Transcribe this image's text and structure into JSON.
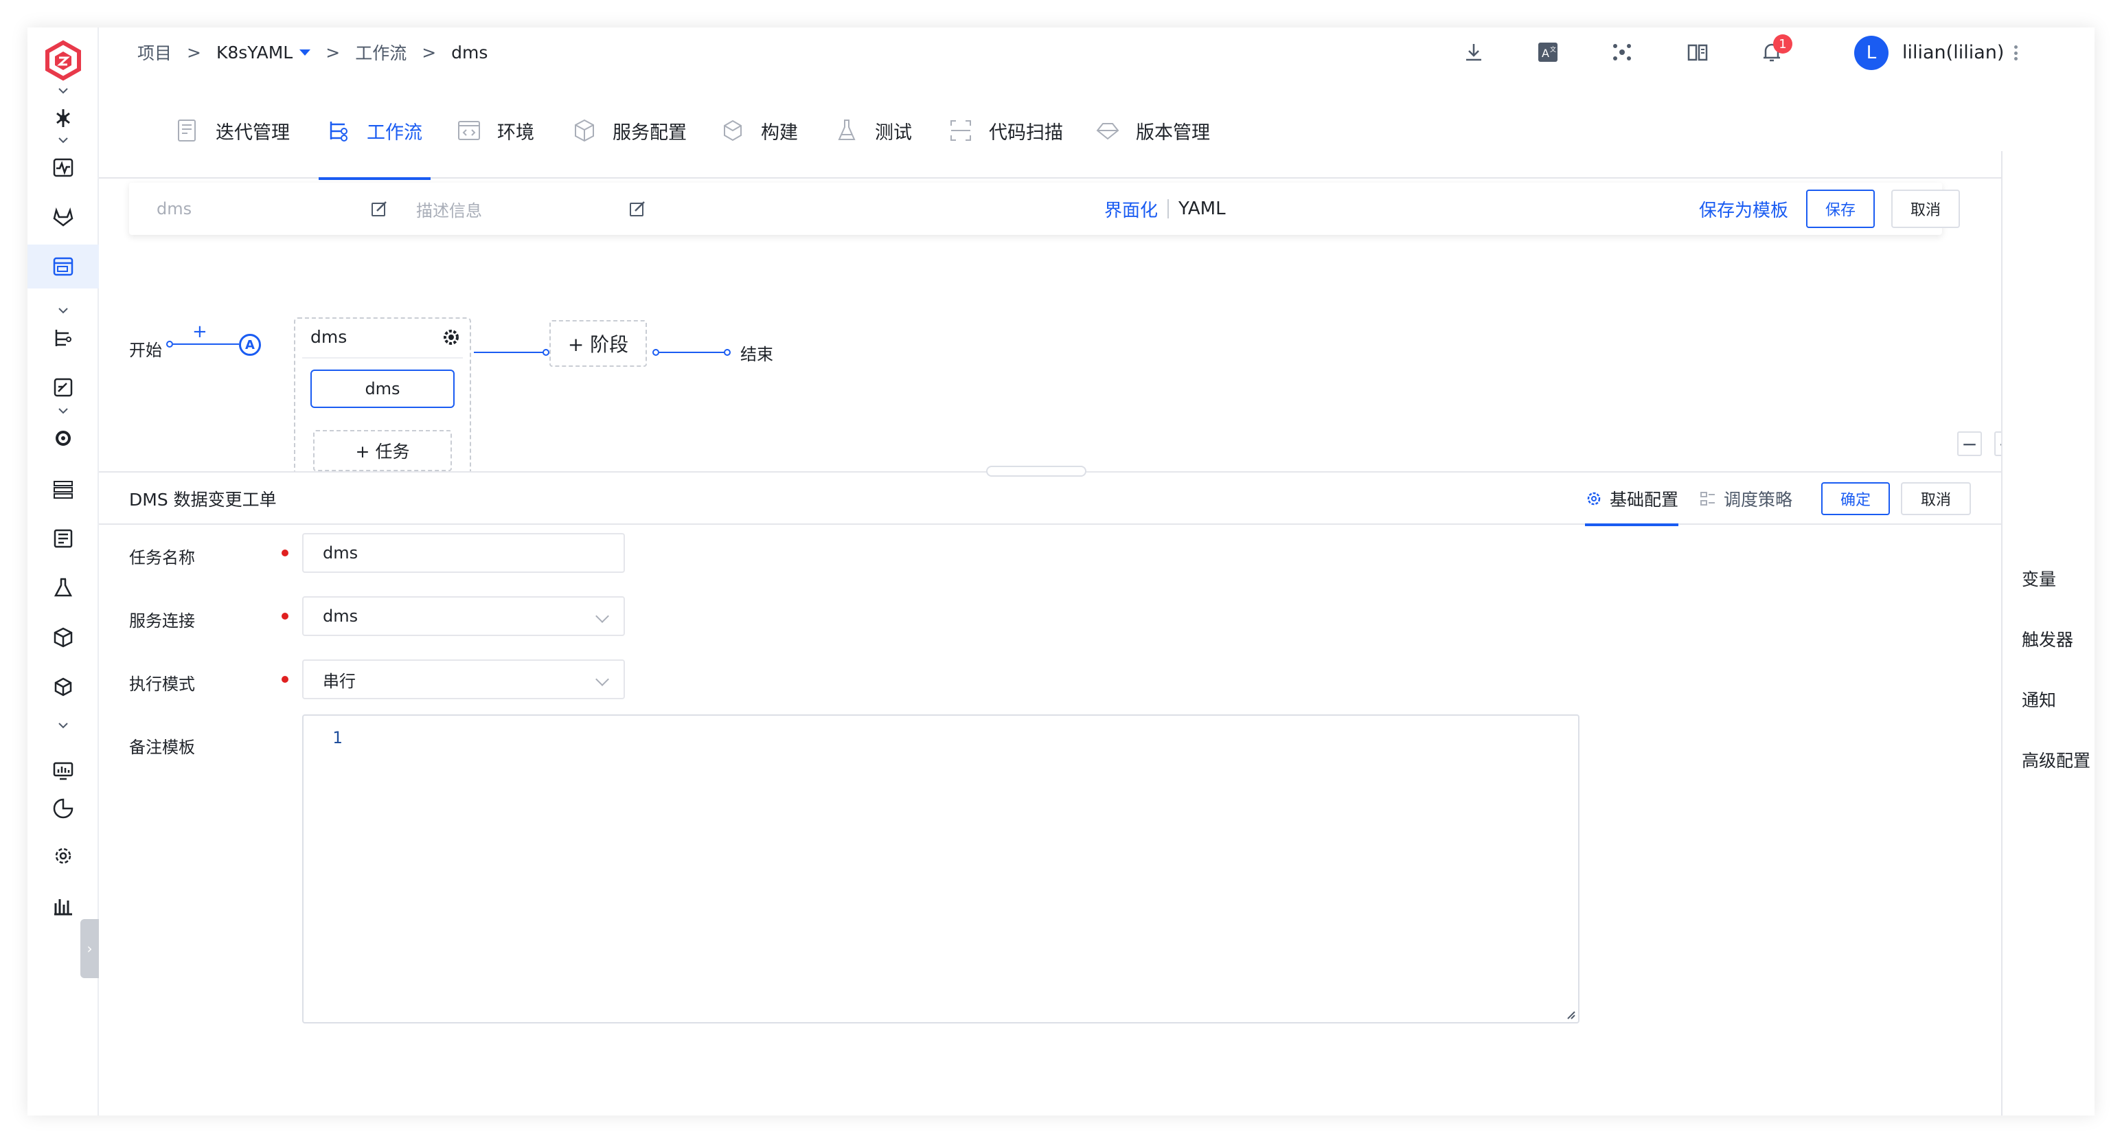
{
  "breadcrumb": {
    "project_root": "项目",
    "sep": ">",
    "project": "K8sYAML",
    "section": "工作流",
    "current": "dms"
  },
  "user": {
    "initial": "L",
    "name": "lilian(lilian)"
  },
  "notifications": {
    "count": "1"
  },
  "tabs": [
    {
      "label": "迭代管理",
      "icon": "iteration-icon"
    },
    {
      "label": "工作流",
      "icon": "workflow-icon"
    },
    {
      "label": "环境",
      "icon": "environment-icon"
    },
    {
      "label": "服务配置",
      "icon": "service-config-icon"
    },
    {
      "label": "构建",
      "icon": "build-icon"
    },
    {
      "label": "测试",
      "icon": "test-icon"
    },
    {
      "label": "代码扫描",
      "icon": "code-scan-icon"
    },
    {
      "label": "版本管理",
      "icon": "version-icon"
    }
  ],
  "editor": {
    "name": "dms",
    "description_placeholder": "描述信息",
    "mode_ui": "界面化",
    "mode_yaml": "YAML",
    "save_as_template": "保存为模板",
    "save": "保存",
    "cancel": "取消"
  },
  "pipeline": {
    "start": "开始",
    "end": "结束",
    "start_plus": "+",
    "start_node": "A",
    "stage_name": "dms",
    "job_name": "dms",
    "add_task": "+ 任务",
    "add_stage": "+ 阶段",
    "zoom_out": "−",
    "zoom_in": "+"
  },
  "job_panel": {
    "title": "DMS 数据变更工单",
    "tab_basic": "基础配置",
    "tab_schedule": "调度策略",
    "confirm": "确定",
    "cancel": "取消",
    "fields": {
      "task_name_label": "任务名称",
      "task_name_value": "dms",
      "service_conn_label": "服务连接",
      "service_conn_value": "dms",
      "exec_mode_label": "执行模式",
      "exec_mode_value": "串行",
      "remark_label": "备注模板",
      "remark_line_no": "1"
    }
  },
  "side_panel": [
    "变量",
    "触发器",
    "通知",
    "高级配置"
  ],
  "colors": {
    "accent": "#1a5cf2",
    "logo": "#e8394a",
    "required": "#e02020",
    "badge": "#f5444f"
  }
}
